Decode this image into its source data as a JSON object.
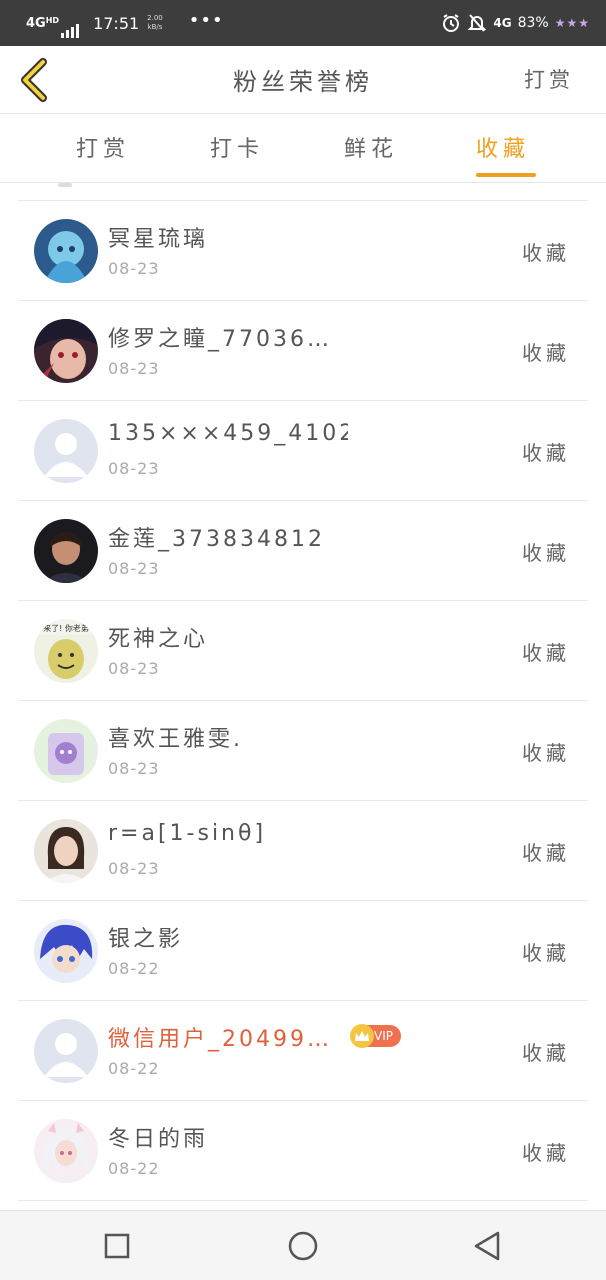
{
  "status_bar": {
    "network": "4G",
    "network_sup": "HD",
    "time": "17:51",
    "speed_value": "2.00",
    "speed_unit": "kB/s",
    "dots": "•••",
    "right_network": "4G",
    "battery": "83%",
    "icons": [
      "alarm-icon",
      "mute-bell-icon",
      "battery-icon"
    ]
  },
  "header": {
    "title": "粉丝荣誉榜",
    "action_label": "打赏",
    "back_icon": "chevron-left-icon"
  },
  "tabs": [
    {
      "label": "打赏",
      "active": false
    },
    {
      "label": "打卡",
      "active": false
    },
    {
      "label": "鲜花",
      "active": false
    },
    {
      "label": "收藏",
      "active": true
    }
  ],
  "accent_color": "#f0a020",
  "vip_name_color": "#e0603a",
  "rows": [
    {
      "name": "冥星琉璃",
      "date": "08-23",
      "action": "收藏",
      "vip": false,
      "avatar": "anime-blue-hair"
    },
    {
      "name": "修罗之瞳_77036…",
      "date": "08-23",
      "action": "收藏",
      "vip": false,
      "avatar": "anime-dark-hair"
    },
    {
      "name": "135×××459_4102…",
      "date": "08-23",
      "action": "收藏",
      "vip": false,
      "avatar": "default-person"
    },
    {
      "name": "金莲_373834812",
      "date": "08-23",
      "action": "收藏",
      "vip": false,
      "avatar": "photo-person"
    },
    {
      "name": "死神之心",
      "date": "08-23",
      "action": "收藏",
      "vip": false,
      "avatar": "meme-face"
    },
    {
      "name": "喜欢王雅雯.",
      "date": "08-23",
      "action": "收藏",
      "vip": false,
      "avatar": "cartoon-cup"
    },
    {
      "name": "r=a[1-sinθ]",
      "date": "08-23",
      "action": "收藏",
      "vip": false,
      "avatar": "photo-woman"
    },
    {
      "name": "银之影",
      "date": "08-22",
      "action": "收藏",
      "vip": false,
      "avatar": "anime-purple-hair"
    },
    {
      "name": "微信用户_20499…",
      "date": "08-22",
      "action": "收藏",
      "vip": true,
      "vip_label": "VIP",
      "avatar": "default-person"
    },
    {
      "name": "冬日的雨",
      "date": "08-22",
      "action": "收藏",
      "vip": false,
      "avatar": "anime-white-hair"
    }
  ],
  "navbar": {
    "icons": [
      "recent-apps-icon",
      "home-icon",
      "back-triangle-icon"
    ]
  }
}
